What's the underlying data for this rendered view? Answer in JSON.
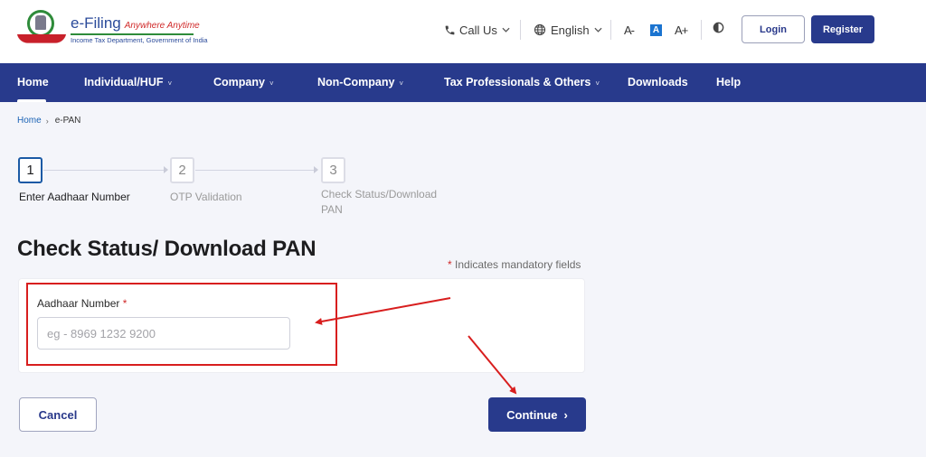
{
  "header": {
    "logo": {
      "title": "e-Filing",
      "tagline": "Anywhere Anytime",
      "subtitle": "Income Tax Department, Government of India"
    },
    "call_us": {
      "label": "Call Us",
      "icon": "phone-icon"
    },
    "language": {
      "selected": "English",
      "icon": "globe-icon"
    },
    "font_controls": [
      {
        "label": "A-",
        "name": "decrease-font"
      },
      {
        "label": "A",
        "name": "default-font"
      },
      {
        "label": "A+",
        "name": "increase-font"
      }
    ],
    "contrast_icon": "contrast-icon",
    "login_label": "Login",
    "register_label": "Register"
  },
  "nav": {
    "items": [
      {
        "label": "Home",
        "dropdown": false,
        "active": true
      },
      {
        "label": "Individual/HUF",
        "dropdown": true
      },
      {
        "label": "Company",
        "dropdown": true
      },
      {
        "label": "Non-Company",
        "dropdown": true
      },
      {
        "label": "Tax Professionals & Others",
        "dropdown": true
      },
      {
        "label": "Downloads",
        "dropdown": false
      },
      {
        "label": "Help",
        "dropdown": false
      }
    ],
    "caret": "˅"
  },
  "breadcrumb": {
    "home": "Home",
    "separator": "›",
    "current": "e-PAN"
  },
  "stepper": {
    "steps": [
      {
        "number": "1",
        "label_line1": "Enter Aadhaar Number",
        "label_line2": "",
        "active": true
      },
      {
        "number": "2",
        "label_line1": "OTP Validation",
        "label_line2": "",
        "active": false
      },
      {
        "number": "3",
        "label_line1": "Check Status/Download",
        "label_line2": "PAN",
        "active": false
      }
    ]
  },
  "main": {
    "title": "Check Status/ Download PAN",
    "mandatory_star": "*",
    "mandatory_note": " Indicates mandatory fields",
    "aadhaar_field": {
      "label": "Aadhaar Number ",
      "required_star": "*",
      "value": "",
      "placeholder": "eg - 8969 1232 9200"
    },
    "cancel_label": "Cancel",
    "continue_label": "Continue",
    "continue_chevron": "›"
  },
  "colors": {
    "brand_navy": "#283a8c",
    "link_blue": "#1b63b5",
    "required_red": "#d02a2a",
    "annotation_red": "#d81e1e",
    "page_bg": "#f4f5fa"
  }
}
